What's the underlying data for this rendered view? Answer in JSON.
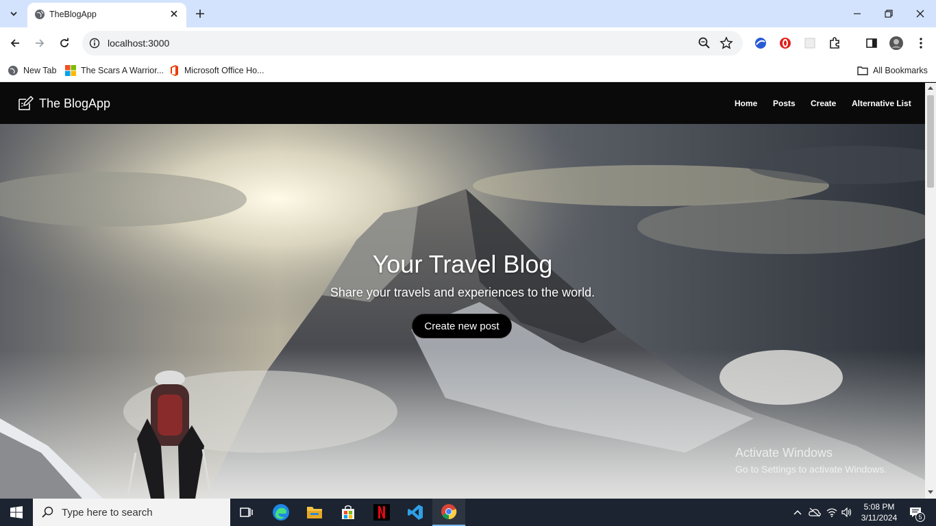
{
  "browser": {
    "tab_title": "TheBlogApp",
    "url": "localhost:3000",
    "bookmarks": [
      {
        "label": "New Tab"
      },
      {
        "label": "The Scars A Warrior..."
      },
      {
        "label": "Microsoft Office Ho..."
      }
    ],
    "all_bookmarks_label": "All Bookmarks"
  },
  "site": {
    "brand": "The BlogApp",
    "nav": [
      {
        "label": "Home"
      },
      {
        "label": "Posts"
      },
      {
        "label": "Create"
      },
      {
        "label": "Alternative List"
      }
    ],
    "hero": {
      "title": "Your Travel Blog",
      "subtitle": "Share your travels and experiences to the world.",
      "cta": "Create new post"
    }
  },
  "watermark": {
    "title": "Activate Windows",
    "subtitle": "Go to Settings to activate Windows."
  },
  "taskbar": {
    "search_placeholder": "Type here to search",
    "time": "5:08 PM",
    "date": "3/11/2024",
    "notification_count": "5"
  },
  "colors": {
    "tabstrip": "#d3e3fd",
    "navbar": "#0a0a0a",
    "taskbar": "#1c2431",
    "accent": "#76b9ed"
  }
}
